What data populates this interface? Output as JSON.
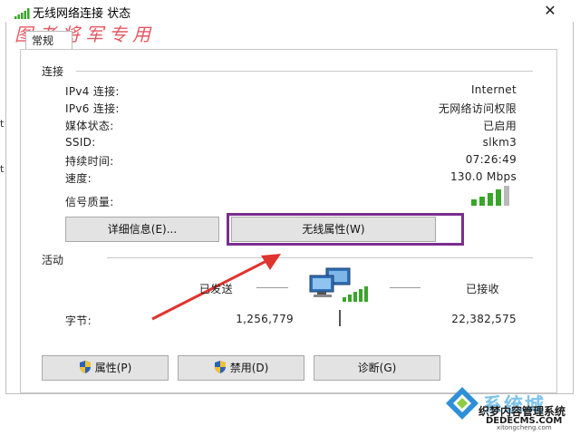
{
  "window": {
    "title": "无线网络连接 状态",
    "close_glyph": "✕",
    "tab_label": "常规"
  },
  "watermark_top": "图老将军专用",
  "connection": {
    "section_label": "连接",
    "rows": [
      {
        "label": "IPv4 连接:",
        "value": "Internet"
      },
      {
        "label": "IPv6 连接:",
        "value": "无网络访问权限"
      },
      {
        "label": "媒体状态:",
        "value": "已启用"
      },
      {
        "label": "SSID:",
        "value": "slkm3"
      },
      {
        "label": "持续时间:",
        "value": "07:26:49"
      },
      {
        "label": "速度:",
        "value": "130.0 Mbps"
      }
    ],
    "signal_label": "信号质量:",
    "signal_bars_lit": 4,
    "signal_bars_total": 5,
    "details_button": "详细信息(E)...",
    "wireless_props_button": "无线属性(W)"
  },
  "activity": {
    "section_label": "活动",
    "sent_label": "已发送",
    "received_label": "已接收",
    "bytes_label": "字节:",
    "bytes_sent": "1,256,779",
    "bytes_received": "22,382,575"
  },
  "footer_buttons": {
    "properties": "属性(P)",
    "disable": "禁用(D)",
    "diagnose": "诊断(G)"
  },
  "left_crop_glyphs": [
    "t",
    "t"
  ],
  "corner_watermark": {
    "line1": "系统城",
    "line2": "织梦内容管理系统",
    "line3": "DEDECMS.COM",
    "line4": "xitongcheng.com"
  },
  "colors": {
    "highlight_box": "#7a2e8e",
    "arrow": "#e0342f",
    "signal_green": "#3aa52a",
    "signal_gray": "#b9b9b9",
    "watermark_red": "#e23a46"
  },
  "icons": {
    "title": "wifi-signal-icon",
    "network": "network-computers-icon",
    "shield": "uac-shield-icon",
    "logo": "system-city-logo-icon"
  }
}
